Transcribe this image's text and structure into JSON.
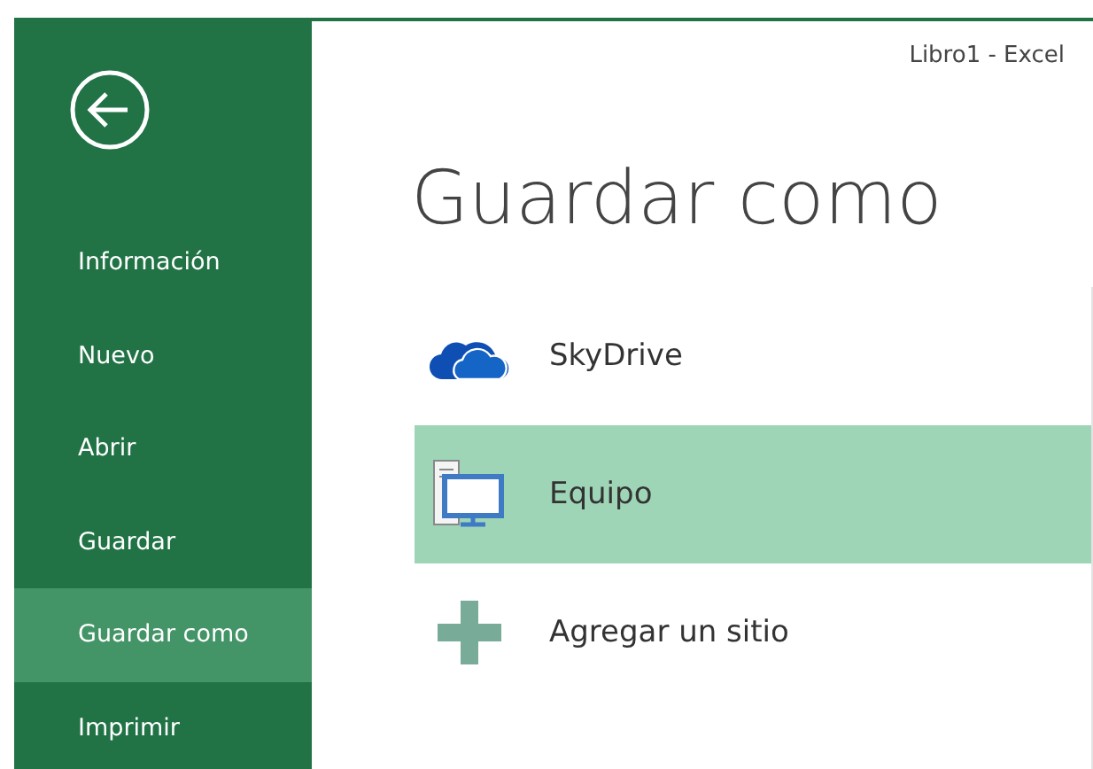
{
  "window": {
    "title": "Libro1 - Excel"
  },
  "sidebar": {
    "items": [
      {
        "label": "Información",
        "selected": false
      },
      {
        "label": "Nuevo",
        "selected": false
      },
      {
        "label": "Abrir",
        "selected": false
      },
      {
        "label": "Guardar",
        "selected": false
      },
      {
        "label": "Guardar como",
        "selected": true
      },
      {
        "label": "Imprimir",
        "selected": false
      }
    ]
  },
  "heading": "Guardar como",
  "places": [
    {
      "kind": "cloud",
      "label": "SkyDrive",
      "selected": false
    },
    {
      "kind": "computer",
      "label": "Equipo",
      "selected": true
    },
    {
      "kind": "add",
      "label": "Agregar un sitio",
      "selected": false
    }
  ]
}
